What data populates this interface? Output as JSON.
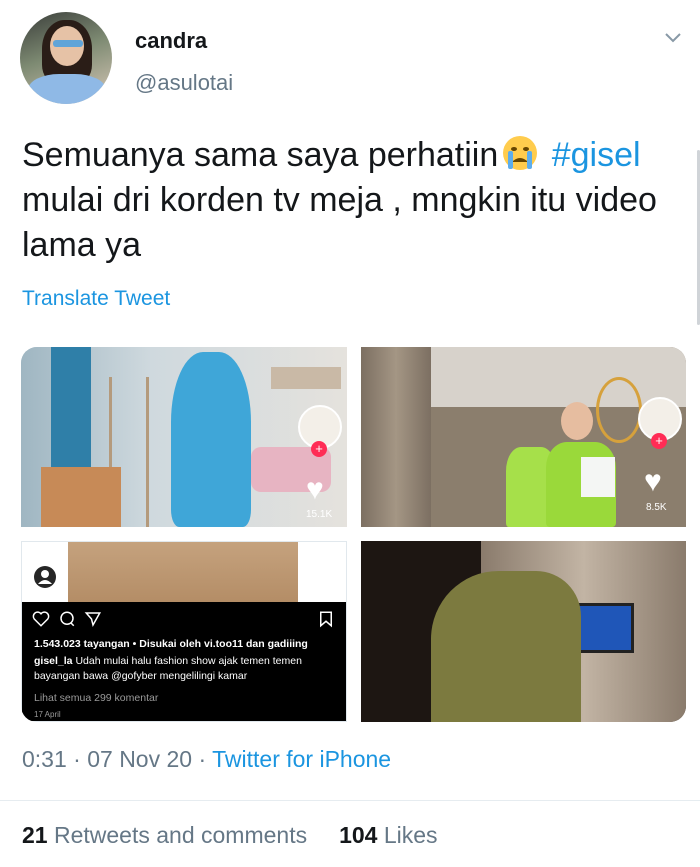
{
  "author": {
    "name": "candra",
    "handle": "@asulotai"
  },
  "tweet": {
    "text_before_emoji": "Semuanya sama saya perhatiin",
    "emoji": "crying-face",
    "hashtag": "#gisel",
    "text_after": "mulai dri korden tv meja , mngkin itu video lama ya"
  },
  "translate_label": "Translate Tweet",
  "media": {
    "tiktok1_likes": "15.1K",
    "tiktok2_likes": "8.5K",
    "instagram": {
      "stats": "1.543.023 tayangan • Disukai oleh vi.too11 dan gadiiing",
      "caption_user": "gisel_la",
      "caption_text": "Udah mulai halu fashion show ajak temen temen bayangan bawa @gofyber mengelilingi kamar",
      "comments": "Lihat semua 299 komentar",
      "date": "17 April"
    }
  },
  "meta": {
    "time": "0:31",
    "separator1": "·",
    "date": "07 Nov 20",
    "separator2": "·",
    "source": "Twitter for iPhone"
  },
  "stats": {
    "retweets_count": "21",
    "retweets_label": "Retweets and comments",
    "likes_count": "104",
    "likes_label": "Likes"
  },
  "colors": {
    "link": "#1b95e0",
    "secondary": "#657786",
    "primary_text": "#14171a",
    "divider": "#e6ecf0",
    "tiktok_red": "#ff2c55"
  },
  "icons": [
    "chevron-down-icon",
    "crying-face-emoji",
    "heart-icon",
    "plus-icon",
    "instagram-heart-icon",
    "instagram-comment-icon",
    "instagram-share-icon",
    "instagram-bookmark-icon",
    "user-placeholder-icon"
  ]
}
